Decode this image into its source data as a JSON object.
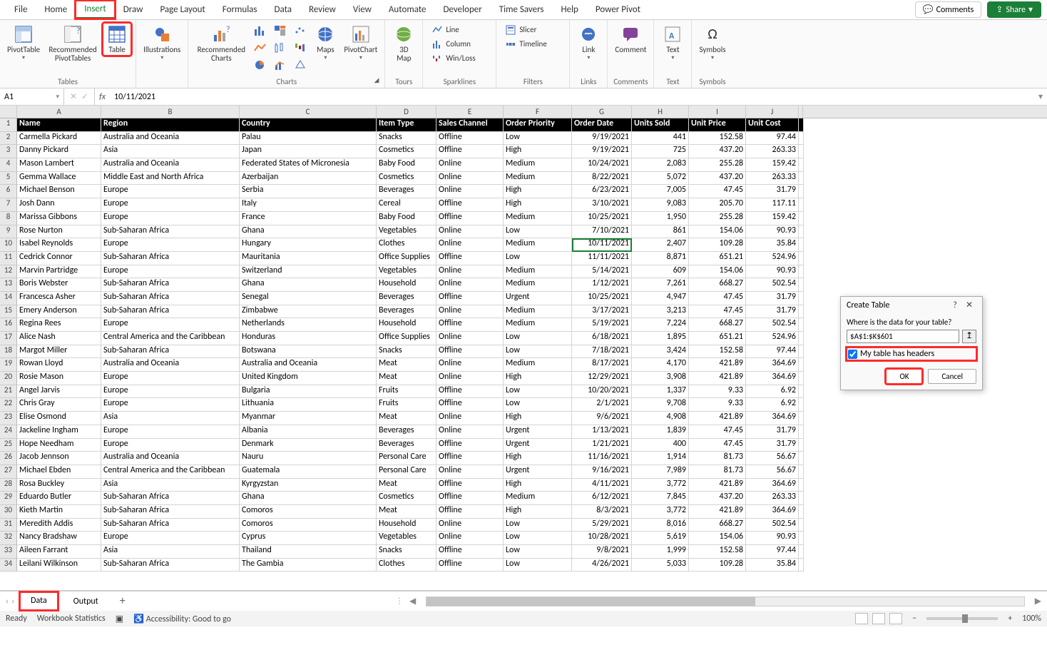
{
  "ribbonTabs": [
    "File",
    "Home",
    "Insert",
    "Draw",
    "Page Layout",
    "Formulas",
    "Data",
    "Review",
    "View",
    "Automate",
    "Developer",
    "Time Savers",
    "Help",
    "Power Pivot"
  ],
  "activeTab": "Insert",
  "comments": "Comments",
  "share": "Share",
  "groups": {
    "tables": {
      "label": "Tables",
      "pivot": "PivotTable",
      "recPivot": "Recommended\nPivotTables",
      "table": "Table"
    },
    "illustrations": {
      "label": "",
      "illus": "Illustrations"
    },
    "charts": {
      "label": "Charts",
      "rec": "Recommended\nCharts",
      "maps": "Maps",
      "pivotChart": "PivotChart"
    },
    "tours": {
      "label": "Tours",
      "map3d": "3D\nMap"
    },
    "sparklines": {
      "label": "Sparklines",
      "line": "Line",
      "column": "Column",
      "winloss": "Win/Loss"
    },
    "filters": {
      "label": "Filters",
      "slicer": "Slicer",
      "timeline": "Timeline"
    },
    "links": {
      "label": "Links",
      "link": "Link"
    },
    "commentsGrp": {
      "label": "Comments",
      "comment": "Comment"
    },
    "text": {
      "label": "Text",
      "text": "Text"
    },
    "symbols": {
      "label": "Symbols",
      "symbols": "Symbols"
    }
  },
  "nameBox": "A1",
  "formulaValue": "10/11/2021",
  "colHeaders": [
    "A",
    "B",
    "C",
    "D",
    "E",
    "F",
    "G",
    "H",
    "I",
    "J"
  ],
  "tableHeaders": [
    "Name",
    "Region",
    "Country",
    "Item Type",
    "Sales Channel",
    "Order Priority",
    "Order Date",
    "Units Sold",
    "Unit Price",
    "Unit Cost"
  ],
  "rows": [
    [
      "Carmella Pickard",
      "Australia and Oceania",
      "Palau",
      "Snacks",
      "Offline",
      "Low",
      "9/19/2021",
      "441",
      "152.58",
      "97.44"
    ],
    [
      "Danny Pickard",
      "Asia",
      "Japan",
      "Cosmetics",
      "Offline",
      "High",
      "9/19/2021",
      "725",
      "437.20",
      "263.33"
    ],
    [
      "Mason Lambert",
      "Australia and Oceania",
      "Federated States of Micronesia",
      "Baby Food",
      "Online",
      "Medium",
      "10/24/2021",
      "2,083",
      "255.28",
      "159.42"
    ],
    [
      "Gemma Wallace",
      "Middle East and North Africa",
      "Azerbaijan",
      "Cosmetics",
      "Online",
      "Medium",
      "8/22/2021",
      "5,072",
      "437.20",
      "263.33"
    ],
    [
      "Michael Benson",
      "Europe",
      "Serbia",
      "Beverages",
      "Online",
      "High",
      "6/23/2021",
      "7,005",
      "47.45",
      "31.79"
    ],
    [
      "Josh Dann",
      "Europe",
      "Italy",
      "Cereal",
      "Offline",
      "High",
      "3/10/2021",
      "9,083",
      "205.70",
      "117.11"
    ],
    [
      "Marissa Gibbons",
      "Europe",
      "France",
      "Baby Food",
      "Offline",
      "Medium",
      "10/25/2021",
      "1,950",
      "255.28",
      "159.42"
    ],
    [
      "Rose Nurton",
      "Sub-Saharan Africa",
      "Ghana",
      "Vegetables",
      "Online",
      "Low",
      "7/10/2021",
      "861",
      "154.06",
      "90.93"
    ],
    [
      "Isabel Reynolds",
      "Europe",
      "Hungary",
      "Clothes",
      "Online",
      "Medium",
      "10/11/2021",
      "2,407",
      "109.28",
      "35.84"
    ],
    [
      "Cedrick Connor",
      "Sub-Saharan Africa",
      "Mauritania",
      "Office Supplies",
      "Offline",
      "Low",
      "11/11/2021",
      "8,871",
      "651.21",
      "524.96"
    ],
    [
      "Marvin Partridge",
      "Europe",
      "Switzerland",
      "Vegetables",
      "Online",
      "Medium",
      "5/14/2021",
      "609",
      "154.06",
      "90.93"
    ],
    [
      "Boris Webster",
      "Sub-Saharan Africa",
      "Ghana",
      "Household",
      "Online",
      "Medium",
      "1/12/2021",
      "7,261",
      "668.27",
      "502.54"
    ],
    [
      "Francesca Asher",
      "Sub-Saharan Africa",
      "Senegal",
      "Beverages",
      "Offline",
      "Urgent",
      "10/25/2021",
      "4,947",
      "47.45",
      "31.79"
    ],
    [
      "Emery Anderson",
      "Sub-Saharan Africa",
      "Zimbabwe",
      "Beverages",
      "Online",
      "Medium",
      "3/17/2021",
      "3,213",
      "47.45",
      "31.79"
    ],
    [
      "Regina Rees",
      "Europe",
      "Netherlands",
      "Household",
      "Offline",
      "Medium",
      "5/19/2021",
      "7,224",
      "668.27",
      "502.54"
    ],
    [
      "Alice Nash",
      "Central America and the Caribbean",
      "Honduras",
      "Office Supplies",
      "Online",
      "Low",
      "6/18/2021",
      "1,895",
      "651.21",
      "524.96"
    ],
    [
      "Margot Miller",
      "Sub-Saharan Africa",
      "Botswana",
      "Snacks",
      "Offline",
      "Low",
      "7/18/2021",
      "3,424",
      "152.58",
      "97.44"
    ],
    [
      "Rowan Lloyd",
      "Australia and Oceania",
      "Australia and Oceania",
      "Meat",
      "Online",
      "Medium",
      "8/17/2021",
      "4,170",
      "421.89",
      "364.69"
    ],
    [
      "Rosie Mason",
      "Europe",
      "United Kingdom",
      "Meat",
      "Online",
      "High",
      "12/29/2021",
      "3,908",
      "421.89",
      "364.69"
    ],
    [
      "Angel Jarvis",
      "Europe",
      "Bulgaria",
      "Fruits",
      "Offline",
      "Low",
      "10/20/2021",
      "1,337",
      "9.33",
      "6.92"
    ],
    [
      "Chris Gray",
      "Europe",
      "Lithuania",
      "Fruits",
      "Offline",
      "Low",
      "2/1/2021",
      "9,708",
      "9.33",
      "6.92"
    ],
    [
      "Elise Osmond",
      "Asia",
      "Myanmar",
      "Meat",
      "Online",
      "High",
      "9/6/2021",
      "4,908",
      "421.89",
      "364.69"
    ],
    [
      "Jackeline Ingham",
      "Europe",
      "Albania",
      "Beverages",
      "Online",
      "Urgent",
      "1/13/2021",
      "1,839",
      "47.45",
      "31.79"
    ],
    [
      "Hope Needham",
      "Europe",
      "Denmark",
      "Beverages",
      "Offline",
      "Urgent",
      "1/21/2021",
      "400",
      "47.45",
      "31.79"
    ],
    [
      "Jacob Jennson",
      "Australia and Oceania",
      "Nauru",
      "Personal Care",
      "Offline",
      "High",
      "11/16/2021",
      "1,914",
      "81.73",
      "56.67"
    ],
    [
      "Michael Ebden",
      "Central America and the Caribbean",
      "Guatemala",
      "Personal Care",
      "Online",
      "Urgent",
      "9/16/2021",
      "7,989",
      "81.73",
      "56.67"
    ],
    [
      "Rosa Buckley",
      "Asia",
      "Kyrgyzstan",
      "Meat",
      "Offline",
      "High",
      "4/11/2021",
      "3,772",
      "421.89",
      "364.69"
    ],
    [
      "Eduardo Butler",
      "Sub-Saharan Africa",
      "Ghana",
      "Cosmetics",
      "Offline",
      "Medium",
      "6/12/2021",
      "7,845",
      "437.20",
      "263.33"
    ],
    [
      "Kieth Martin",
      "Sub-Saharan Africa",
      "Comoros",
      "Meat",
      "Offline",
      "High",
      "8/3/2021",
      "3,772",
      "421.89",
      "364.69"
    ],
    [
      "Meredith Addis",
      "Sub-Saharan Africa",
      "Comoros",
      "Household",
      "Online",
      "Low",
      "5/29/2021",
      "8,016",
      "668.27",
      "502.54"
    ],
    [
      "Nancy Bradshaw",
      "Europe",
      "Cyprus",
      "Vegetables",
      "Online",
      "Low",
      "10/28/2021",
      "5,619",
      "154.06",
      "90.93"
    ],
    [
      "Aileen Farrant",
      "Asia",
      "Thailand",
      "Snacks",
      "Offline",
      "Low",
      "9/8/2021",
      "1,999",
      "152.58",
      "97.44"
    ],
    [
      "Leilani Wilkinson",
      "Sub-Saharan Africa",
      "The Gambia",
      "Clothes",
      "Offline",
      "Low",
      "4/26/2021",
      "5,033",
      "109.28",
      "35.84"
    ]
  ],
  "sheets": {
    "active": "Data",
    "other": "Output"
  },
  "status": {
    "ready": "Ready",
    "stats": "Workbook Statistics",
    "access": "Accessibility: Good to go",
    "zoom": "100%"
  },
  "dialog": {
    "title": "Create Table",
    "prompt": "Where is the data for your table?",
    "range": "$A$1:$K$601",
    "chk": "My table has headers",
    "ok": "OK",
    "cancel": "Cancel"
  }
}
